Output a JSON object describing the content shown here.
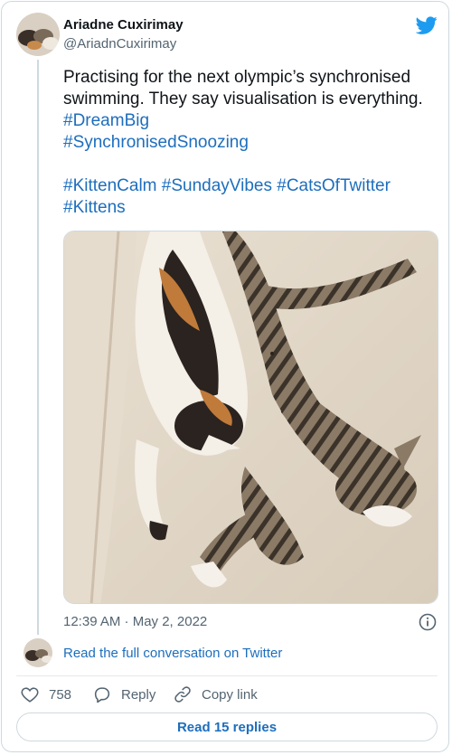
{
  "author": {
    "name": "Ariadne Cuxirimay",
    "handle": "@AriadnCuxirimay"
  },
  "tweet": {
    "text_line1": "Practising for the next olympic’s synchronised swimming. They say visualisation is everything. ",
    "tags_line1": [
      "#DreamBig",
      "#SynchronisedSnoozing"
    ],
    "tags_line2": [
      "#KittenCalm",
      "#SundayVibes",
      "#CatsOfTwitter",
      "#Kittens"
    ],
    "timestamp": "12:39 AM · May 2, 2022"
  },
  "conversation_link": "Read the full conversation on Twitter",
  "actions": {
    "like_count": "758",
    "reply_label": "Reply",
    "copy_label": "Copy link"
  },
  "replies_button": "Read 15 replies",
  "colors": {
    "accent": "#1d9bf0",
    "link": "#1d6ebd",
    "secondary_text": "#536471",
    "border": "#cfd9de"
  },
  "icons": [
    "twitter-bird-icon",
    "info-icon",
    "heart-icon",
    "reply-bubble-icon",
    "link-icon"
  ]
}
